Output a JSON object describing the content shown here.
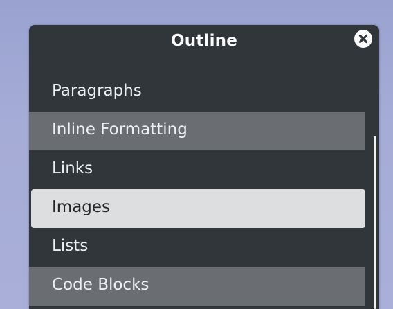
{
  "window": {
    "title": "Outline",
    "close_icon": "close-icon",
    "colors": {
      "background": "#31363b",
      "alternate_row": "#6a6e72",
      "selected_row": "#dcdee0",
      "text": "#eff0f1",
      "selected_text": "#232629",
      "desktop": "#a5acd6"
    }
  },
  "outline": {
    "items": [
      {
        "label": "Paragraphs"
      },
      {
        "label": "Inline Formatting"
      },
      {
        "label": "Links"
      },
      {
        "label": "Images"
      },
      {
        "label": "Lists"
      },
      {
        "label": "Code Blocks"
      }
    ],
    "selected": "Images"
  }
}
